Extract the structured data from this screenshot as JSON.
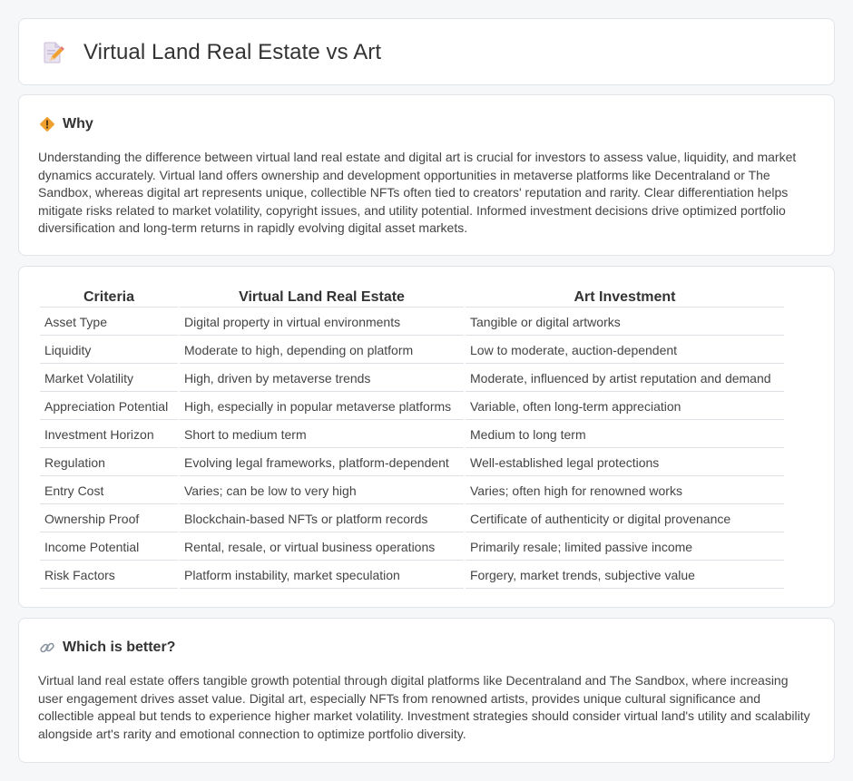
{
  "header": {
    "title": "Virtual Land Real Estate vs Art",
    "icon": "document-edit-icon"
  },
  "why": {
    "title": "Why",
    "icon": "diamond-warning-icon",
    "text": "Understanding the difference between virtual land real estate and digital art is crucial for investors to assess value, liquidity, and market dynamics accurately. Virtual land offers ownership and development opportunities in metaverse platforms like Decentraland or The Sandbox, whereas digital art represents unique, collectible NFTs often tied to creators' reputation and rarity. Clear differentiation helps mitigate risks related to market volatility, copyright issues, and utility potential. Informed investment decisions drive optimized portfolio diversification and long-term returns in rapidly evolving digital asset markets."
  },
  "table": {
    "headers": [
      "Criteria",
      "Virtual Land Real Estate",
      "Art Investment"
    ],
    "rows": [
      [
        "Asset Type",
        "Digital property in virtual environments",
        "Tangible or digital artworks"
      ],
      [
        "Liquidity",
        "Moderate to high, depending on platform",
        "Low to moderate, auction-dependent"
      ],
      [
        "Market Volatility",
        "High, driven by metaverse trends",
        "Moderate, influenced by artist reputation and demand"
      ],
      [
        "Appreciation Potential",
        "High, especially in popular metaverse platforms",
        "Variable, often long-term appreciation"
      ],
      [
        "Investment Horizon",
        "Short to medium term",
        "Medium to long term"
      ],
      [
        "Regulation",
        "Evolving legal frameworks, platform-dependent",
        "Well-established legal protections"
      ],
      [
        "Entry Cost",
        "Varies; can be low to very high",
        "Varies; often high for renowned works"
      ],
      [
        "Ownership Proof",
        "Blockchain-based NFTs or platform records",
        "Certificate of authenticity or digital provenance"
      ],
      [
        "Income Potential",
        "Rental, resale, or virtual business operations",
        "Primarily resale; limited passive income"
      ],
      [
        "Risk Factors",
        "Platform instability, market speculation",
        "Forgery, market trends, subjective value"
      ]
    ]
  },
  "better": {
    "title": "Which is better?",
    "icon": "link-icon",
    "text": "Virtual land real estate offers tangible growth potential through digital platforms like Decentraland and The Sandbox, where increasing user engagement drives asset value. Digital art, especially NFTs from renowned artists, provides unique cultural significance and collectible appeal but tends to experience higher market volatility. Investment strategies should consider virtual land's utility and scalability alongside art's rarity and emotional connection to optimize portfolio diversity."
  },
  "colors": {
    "background": "#f6f7f9",
    "card": "#ffffff",
    "border": "#e1e4e8",
    "icon_orange": "#f0a030",
    "icon_pink": "#e87a7a"
  }
}
